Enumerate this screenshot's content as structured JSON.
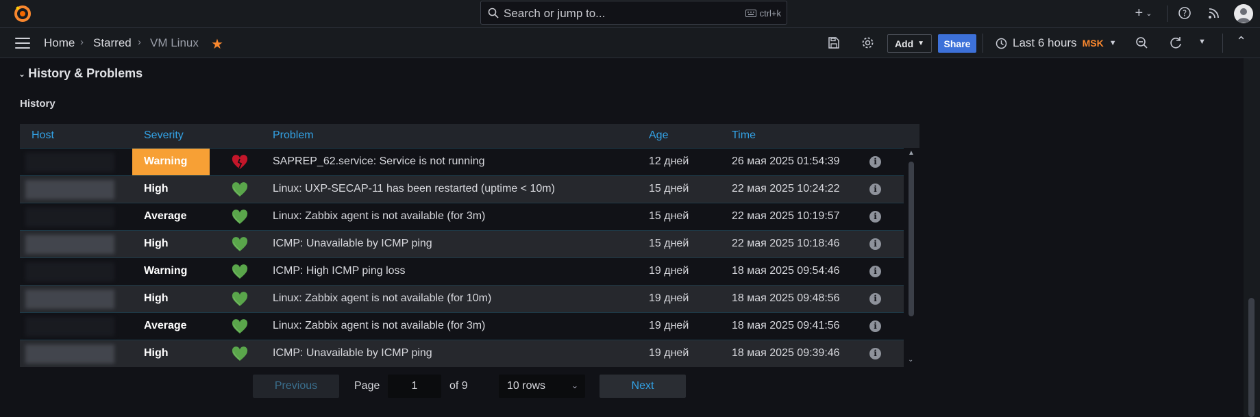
{
  "topbar": {
    "search_placeholder": "Search or jump to...",
    "search_shortcut": "ctrl+k",
    "icons": [
      "grafana-logo-icon",
      "search-icon",
      "keyboard-icon",
      "plus-icon",
      "help-icon",
      "news-icon",
      "user-avatar"
    ]
  },
  "navbar": {
    "breadcrumbs": [
      "Home",
      "Starred",
      "VM Linux"
    ],
    "add_label": "Add",
    "share_label": "Share",
    "time_range": "Last 6 hours",
    "timezone": "MSK"
  },
  "dashboard": {
    "row_title": "History & Problems",
    "panel_title": "History"
  },
  "table": {
    "columns": [
      "Host",
      "Severity",
      "Problem",
      "Age",
      "Time"
    ],
    "rows": [
      {
        "host": "",
        "severity": "Warning",
        "status": "problem",
        "problem": "SAPREP_62.service: Service is not running",
        "age": "12 дней",
        "time": "26 мая 2025 01:54:39"
      },
      {
        "host": "",
        "severity": "High",
        "status": "ok",
        "problem": "Linux: UXP-SECAP-11 has been restarted (uptime < 10m)",
        "age": "15 дней",
        "time": "22 мая 2025 10:24:22"
      },
      {
        "host": "",
        "severity": "Average",
        "status": "ok",
        "problem": "Linux: Zabbix agent is not available (for 3m)",
        "age": "15 дней",
        "time": "22 мая 2025 10:19:57"
      },
      {
        "host": "",
        "severity": "High",
        "status": "ok",
        "problem": "ICMP: Unavailable by ICMP ping",
        "age": "15 дней",
        "time": "22 мая 2025 10:18:46"
      },
      {
        "host": "",
        "severity": "Warning",
        "status": "ok",
        "problem": "ICMP: High ICMP ping loss",
        "age": "19 дней",
        "time": "18 мая 2025 09:54:46"
      },
      {
        "host": "",
        "severity": "High",
        "status": "ok",
        "problem": "Linux: Zabbix agent is not available (for 10m)",
        "age": "19 дней",
        "time": "18 мая 2025 09:48:56"
      },
      {
        "host": "",
        "severity": "Average",
        "status": "ok",
        "problem": "Linux: Zabbix agent is not available (for 3m)",
        "age": "19 дней",
        "time": "18 мая 2025 09:41:56"
      },
      {
        "host": "",
        "severity": "High",
        "status": "ok",
        "problem": "ICMP: Unavailable by ICMP ping",
        "age": "19 дней",
        "time": "18 мая 2025 09:39:46"
      }
    ]
  },
  "pagination": {
    "previous_label": "Previous",
    "page_label": "Page",
    "current_page": "1",
    "of_label": "of 9",
    "rows_option": "10 rows",
    "next_label": "Next"
  },
  "colors": {
    "accent": "#33a2e5",
    "warning": "#f7a035",
    "brand": "#f8872e",
    "ok_heart": "#5aa64b",
    "problem_heart": "#c4162a"
  }
}
